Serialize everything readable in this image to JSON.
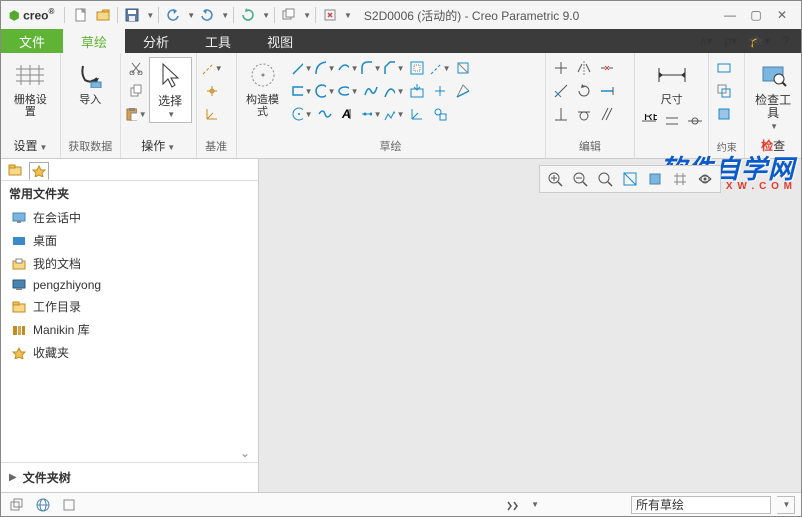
{
  "app": {
    "brand": "creo",
    "title": "S2D0006 (活动的) - Creo Parametric 9.0"
  },
  "tabs": {
    "file": "文件",
    "sketch": "草绘",
    "analysis": "分析",
    "tools": "工具",
    "view": "视图"
  },
  "ribbon": {
    "g1": {
      "grid": "栅格设置",
      "setup": "设置"
    },
    "g2": {
      "import": "导入",
      "getdata": "获取数据"
    },
    "g3": {
      "select": "选择",
      "ops": "操作"
    },
    "g4": {
      "datum": "基准"
    },
    "g5": {
      "constr": "构造模式",
      "sketch": "草绘"
    },
    "g6": {
      "edit": "编辑"
    },
    "g7": {
      "dim": "尺寸"
    },
    "g8": {
      "inspect": "检查工具",
      "inspectgrp": "检查"
    }
  },
  "sidebar": {
    "header": "常用文件夹",
    "items": [
      {
        "label": "在会话中"
      },
      {
        "label": "桌面"
      },
      {
        "label": "我的文档"
      },
      {
        "label": "pengzhiyong"
      },
      {
        "label": "工作目录"
      },
      {
        "label": "Manikin 库"
      },
      {
        "label": "收藏夹"
      }
    ],
    "footer": "文件夹树"
  },
  "status": {
    "filter": "所有草绘"
  },
  "watermark": {
    "l1": "软件自学网",
    "l2": "W W W . R J Z X W . C O M"
  }
}
